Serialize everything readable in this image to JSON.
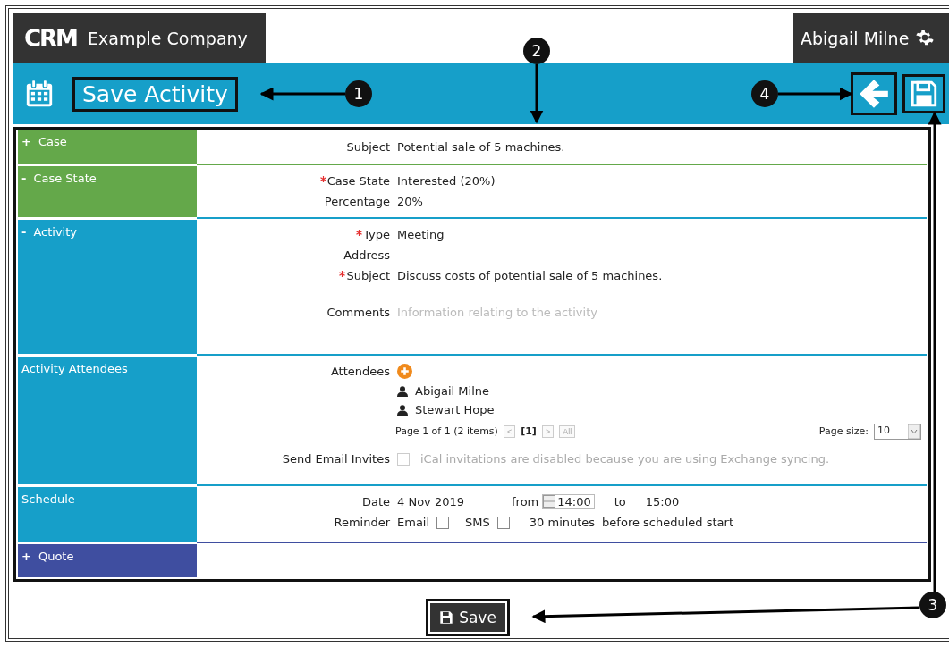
{
  "header": {
    "logo": "CRM",
    "company": "Example Company",
    "user": "Abigail Milne"
  },
  "toolbar": {
    "title": "Save Activity"
  },
  "sections": [
    {
      "toggle": "+",
      "title": "Case",
      "color": "#64a84a",
      "fields": [
        {
          "kind": "text",
          "label": "Subject",
          "required": false,
          "value": "Potential sale of 5 machines."
        }
      ]
    },
    {
      "toggle": "-",
      "title": "Case State",
      "color": "#64a84a",
      "fields": [
        {
          "kind": "text",
          "label": "Case State",
          "required": true,
          "value": "Interested (20%)"
        },
        {
          "kind": "text",
          "label": "Percentage",
          "required": false,
          "value": "20%"
        }
      ]
    },
    {
      "toggle": "-",
      "title": "Activity",
      "color": "#169fc9",
      "fields": [
        {
          "kind": "text",
          "label": "Type",
          "required": true,
          "value": "Meeting"
        },
        {
          "kind": "text",
          "label": "Address",
          "required": false
        },
        {
          "kind": "text",
          "label": "Subject",
          "required": true,
          "value": "Discuss costs of potential sale of 5 machines."
        },
        {
          "kind": "comments",
          "label": "Comments",
          "required": false,
          "placeholder": "Information relating to the activity"
        }
      ]
    },
    {
      "title": "Activity Attendees",
      "color": "#169fc9",
      "fields": [
        {
          "kind": "attendees",
          "label": "Attendees",
          "people": [
            "Abigail Milne",
            "Stewart Hope"
          ],
          "pager": {
            "summary": "Page 1 of 1 (2 items)",
            "prev": "<",
            "current": "[1]",
            "next": ">",
            "all": "All",
            "size_label": "Page size:",
            "size": "10"
          }
        },
        {
          "kind": "checkbox",
          "label": "Send Email Invites",
          "checked": false,
          "disabled": true,
          "note": "iCal invitations are disabled because you are using Exchange syncing."
        }
      ]
    },
    {
      "title": "Schedule",
      "color": "#169fc9",
      "fields": [
        {
          "kind": "schedule",
          "date_label": "Date",
          "date": "4 Nov 2019",
          "from_label": "from",
          "from": "14:00",
          "to_label": "to",
          "to": "15:00",
          "reminder_label": "Reminder",
          "email_label": "Email",
          "email_checked": false,
          "sms_label": "SMS",
          "sms_checked": false,
          "lead_time": "30 minutes",
          "lead_note": "before scheduled start"
        }
      ]
    },
    {
      "toggle": "+",
      "title": "Quote",
      "color": "#3f4ea0"
    }
  ],
  "save_button": "Save",
  "callouts": [
    "1",
    "2",
    "3",
    "4"
  ]
}
